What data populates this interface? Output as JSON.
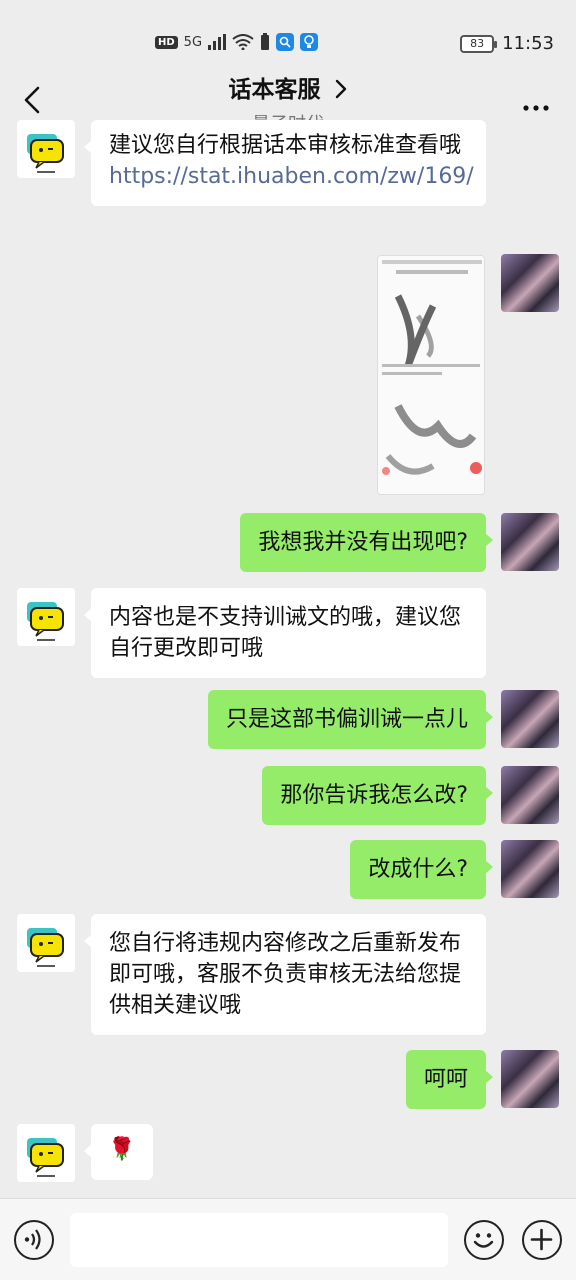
{
  "status_bar": {
    "hd": "HD",
    "network": "5G",
    "battery": "83",
    "time": "11:53"
  },
  "header": {
    "title": "话本客服",
    "subtitle": "量子时代"
  },
  "messages": [
    {
      "side": "in",
      "text": "建议您自行根据话本审核标准查看哦",
      "link": "https://stat.ihuaben.com/zw/169/"
    },
    {
      "side": "out",
      "type": "image"
    },
    {
      "side": "out",
      "text": "我想我并没有出现吧?"
    },
    {
      "side": "in",
      "text": "内容也是不支持训诫文的哦，建议您自行更改即可哦"
    },
    {
      "side": "out",
      "text": "只是这部书偏训诫一点儿"
    },
    {
      "side": "out",
      "text": "那你告诉我怎么改?"
    },
    {
      "side": "out",
      "text": "改成什么?"
    },
    {
      "side": "in",
      "text": "您自行将违规内容修改之后重新发布即可哦，客服不负责审核无法给您提供相关建议哦"
    },
    {
      "side": "out",
      "text": "呵呵"
    },
    {
      "side": "in",
      "text": "🌹"
    }
  ],
  "input": {
    "value": ""
  },
  "colors": {
    "background": "#ededed",
    "incoming_bubble": "#ffffff",
    "outgoing_bubble": "#95ec69",
    "link": "#576b95"
  },
  "icons": [
    "back-arrow-icon",
    "chevron-right-icon",
    "more-icon",
    "voice-icon",
    "emoji-icon",
    "plus-icon"
  ]
}
